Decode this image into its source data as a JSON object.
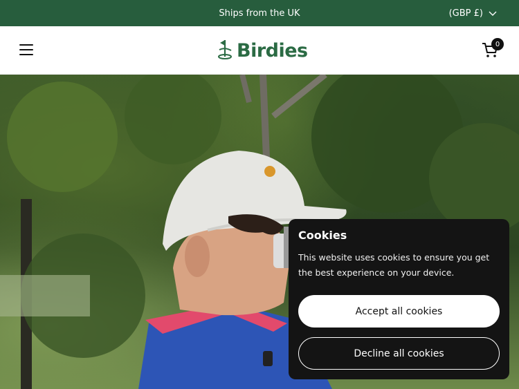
{
  "announcement": {
    "text": "Ships from the UK"
  },
  "currency": {
    "label": "(GBP £)"
  },
  "header": {
    "logo_text": "Birdies",
    "cart_count": "0"
  },
  "cookie_banner": {
    "title": "Cookies",
    "body": "This website uses cookies to ensure you get the best experience on your device.",
    "accept_label": "Accept all cookies",
    "decline_label": "Decline all cookies"
  },
  "colors": {
    "brand_green": "#275d3d",
    "logo_green": "#2b6b44",
    "banner_bg": "#141414"
  }
}
